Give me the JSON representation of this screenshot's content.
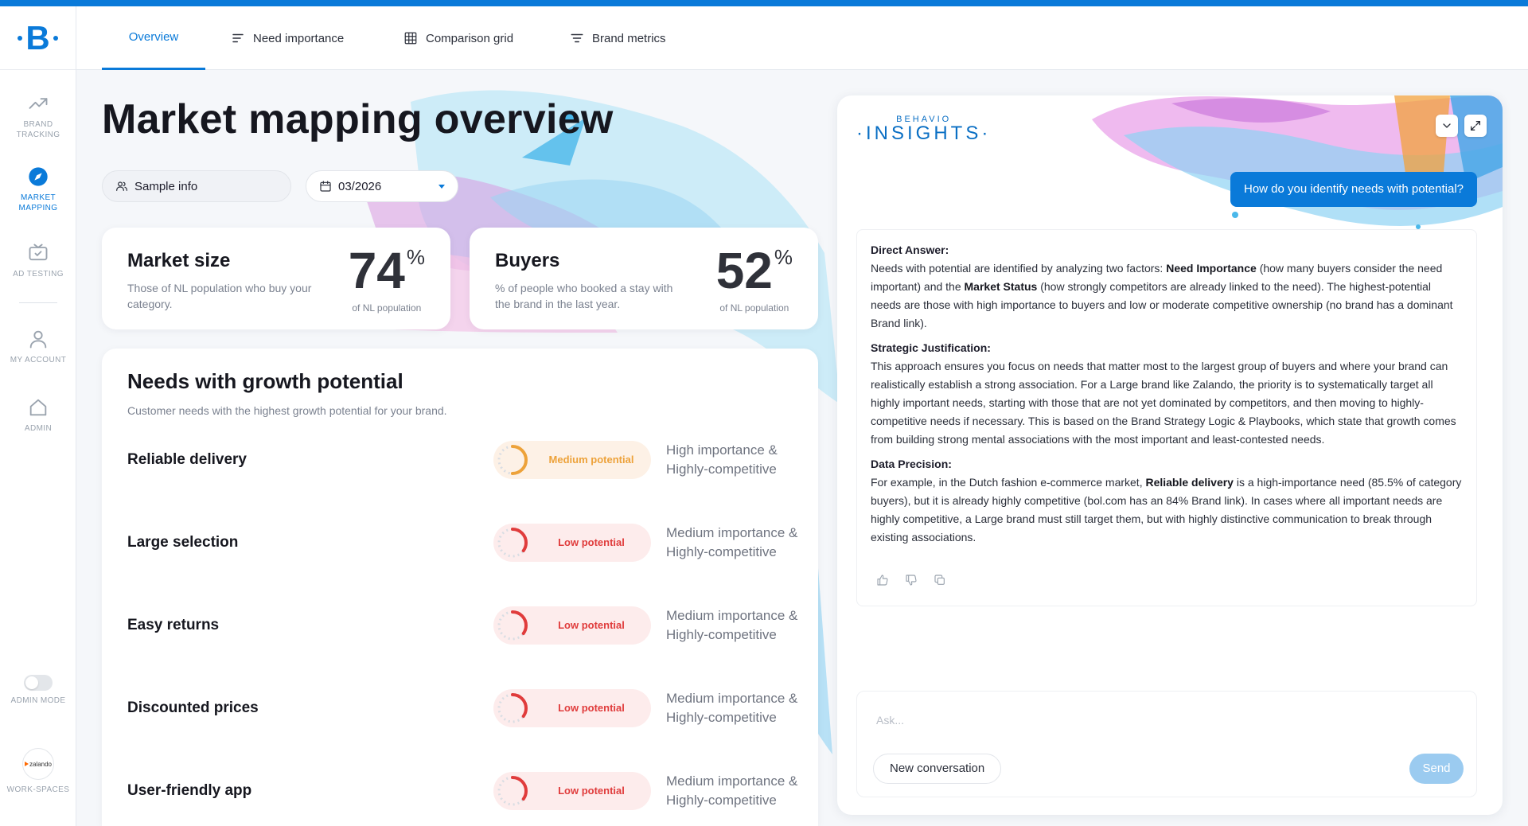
{
  "app": {
    "logo_text": "B"
  },
  "nav": {
    "tabs": [
      {
        "label": "Overview",
        "icon": "none"
      },
      {
        "label": "Need importance",
        "icon": "bars-icon"
      },
      {
        "label": "Comparison grid",
        "icon": "grid-icon"
      },
      {
        "label": "Brand metrics",
        "icon": "filter-icon"
      }
    ],
    "active_tab": 0
  },
  "sidebar": {
    "items": [
      {
        "label": "BRAND TRACKING",
        "icon": "trend-line-icon"
      },
      {
        "label": "MARKET MAPPING",
        "icon": "compass-icon"
      },
      {
        "label": "AD TESTING",
        "icon": "tv-check-icon"
      },
      {
        "label": "MY ACCOUNT",
        "icon": "user-icon"
      },
      {
        "label": "ADMIN",
        "icon": "home-icon"
      },
      {
        "label": "ADMIN MODE",
        "icon": "toggle-icon"
      },
      {
        "label": "WORK-SPACES",
        "icon": "workspace-logo"
      }
    ],
    "workspace_logo_text": "zalando",
    "active_index": 1
  },
  "page": {
    "title": "Market mapping overview",
    "filters": {
      "sample_label": "Sample info",
      "date_value": "03/2026"
    }
  },
  "stats": [
    {
      "title": "Market size",
      "description": "Those of NL population who buy your category.",
      "value": "74",
      "unit": "%",
      "caption": "of NL population"
    },
    {
      "title": "Buyers",
      "description": "% of people who booked a stay with the brand in the last year.",
      "value": "52",
      "unit": "%",
      "caption": "of NL population"
    }
  ],
  "needs": {
    "title": "Needs with growth potential",
    "subtitle": "Customer needs with the highest growth potential for your brand.",
    "rows": [
      {
        "name": "Reliable delivery",
        "potential": "Medium potential",
        "level": 0.5,
        "description": "High importance & Highly-competitive"
      },
      {
        "name": "Large selection",
        "potential": "Low potential",
        "level": 0.35,
        "description": "Medium importance & Highly-competitive"
      },
      {
        "name": "Easy returns",
        "potential": "Low potential",
        "level": 0.35,
        "description": "Medium importance & Highly-competitive"
      },
      {
        "name": "Discounted prices",
        "potential": "Low potential",
        "level": 0.35,
        "description": "Medium importance & Highly-competitive"
      },
      {
        "name": "User-friendly app",
        "potential": "Low potential",
        "level": 0.35,
        "description": "Medium importance & Highly-competitive"
      }
    ]
  },
  "insights": {
    "logo_small": "BEHAVIO",
    "logo_big": "INSIGHTS",
    "question": "How do you identify needs with potential?",
    "answer": {
      "direct_heading": "Direct Answer:",
      "direct_1": "Needs with potential are identified by analyzing two factors: ",
      "direct_b1": "Need Importance",
      "direct_2": " (how many buyers consider the need important) and the ",
      "direct_b2": "Market Status",
      "direct_3": " (how strongly competitors are already linked to the need). The highest-potential needs are those with high importance to buyers and low or moderate competitive ownership (no brand has a dominant Brand link).",
      "strategic_heading": "Strategic Justification:",
      "strategic_text": "This approach ensures you focus on needs that matter most to the largest group of buyers and where your brand can realistically establish a strong association. For a Large brand like Zalando, the priority is to systematically target all highly important needs, starting with those that are not yet dominated by competitors, and then moving to highly-competitive needs if necessary. This is based on the Brand Strategy Logic & Playbooks, which state that growth comes from building strong mental associations with the most important and least-contested needs.",
      "precision_heading": "Data Precision:",
      "precision_1": "For example, in the Dutch fashion e-commerce market, ",
      "precision_b": "Reliable delivery",
      "precision_2": " is a high-importance need (85.5% of category buyers), but it is already highly competitive (bol.com has an 84% Brand link). In cases where all important needs are highly competitive, a Large brand must still target them, but with highly distinctive communication to break through existing associations."
    },
    "input_placeholder": "Ask...",
    "new_conversation_label": "New conversation",
    "send_label": "Send"
  },
  "colors": {
    "accent": "#0a7ad9",
    "low": "#e03c3c",
    "medium": "#eda23a"
  }
}
